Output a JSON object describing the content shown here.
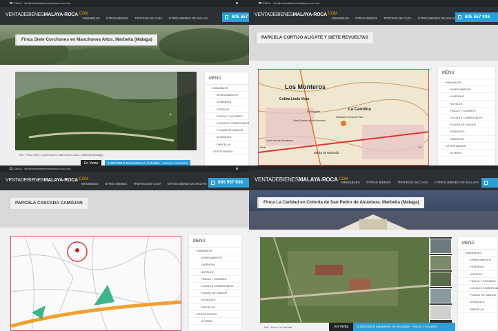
{
  "site": {
    "email": "EMAIL : info@ventadebienesmalaya-roca.com",
    "logo_light": "VENTADEBIENES",
    "logo_bold": "MALAYA-ROCA",
    "logo_com": ".COM",
    "phone": "605 557 936",
    "nav": [
      "INMUEBLES",
      "OTROS BIENES",
      "TROFEOS DE CAZA",
      "OTROS BIENES DE MALAYA"
    ]
  },
  "menu": {
    "title": "MENÚ",
    "items": [
      {
        "label": "INMUEBLES",
        "level": 1
      },
      {
        "label": "APARCAMIENTO",
        "level": 2
      },
      {
        "label": "VIVIENDAS",
        "level": 2
      },
      {
        "label": "HOTELES",
        "level": 2
      },
      {
        "label": "FINCAS Y SOLARES",
        "level": 2
      },
      {
        "label": "LOCALES COMERCIALES",
        "level": 2
      },
      {
        "label": "PLAZAS DE GARAJE",
        "level": 2
      },
      {
        "label": "ATRAQUES",
        "level": 2
      },
      {
        "label": "PARCELAS",
        "level": 2
      },
      {
        "label": "OTROS BIENES",
        "level": 1
      },
      {
        "label": "JOYERIA",
        "level": 2
      }
    ]
  },
  "panels": [
    {
      "title": "Finca Siete Corchones en Manchones Altos. Marbella (Málaga)",
      "caption": "Ref.: Finca Siete Corchones en Manchones Altos. Marbella (Málaga)",
      "status": "En Venta",
      "price": "2.200.000 € Impuestos no incluidos",
      "price_cat": "FINCAS Y SOLARES"
    },
    {
      "title": "PARCELA CORTIJO ALICATE Y SIETE REVUELTAS",
      "map_labels": [
        "Los Monteros",
        "Colina Linda Vista",
        "La Carolina",
        "El Hospital",
        "Casa Grande de los Monteros",
        "Hospital Costa del Sol",
        "Bahía de Marbella",
        "Cerro de los Monteros",
        "Real",
        "A 7"
      ]
    },
    {
      "title": "PARCELA CASCADA CAMOJAN"
    },
    {
      "title": "Finca La Caridad en Colonia de San Pedro de Alcántara. Marbella (Málaga)",
      "caption": "Ref.: Finca La Caridad",
      "status": "En Venta",
      "price": "8.000.000 € Impuestos no incluidos",
      "price_cat": "FINCAS Y SOLARES"
    }
  ],
  "colors": {
    "accent": "#2d9ed6",
    "header": "#2c2f33",
    "topbar": "#232629",
    "logo_com": "#e0a400"
  }
}
